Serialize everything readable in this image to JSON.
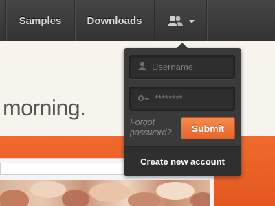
{
  "nav": {
    "samples_label": "Samples",
    "downloads_label": "Downloads",
    "account_icon": "users-icon"
  },
  "hero": {
    "text": "morning."
  },
  "login": {
    "username_placeholder": "Username",
    "password_value": "********",
    "forgot_label": "Forgot password?",
    "submit_label": "Submit",
    "create_account_label": "Create new account"
  },
  "colors": {
    "accent_orange": "#e8632a",
    "nav_dark": "#3c3c3c",
    "panel_dark": "#3a3a3a"
  }
}
